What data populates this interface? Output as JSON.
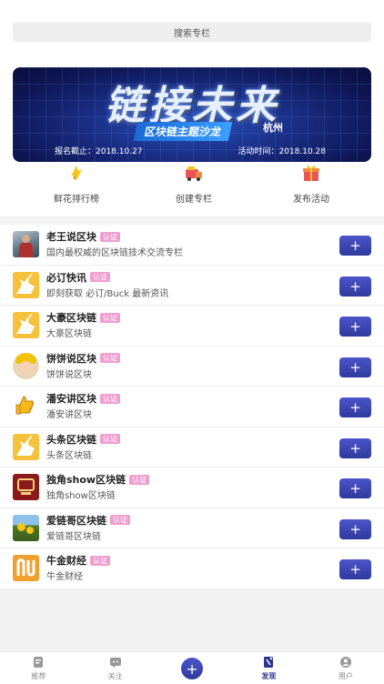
{
  "search": {
    "placeholder": "搜索专栏"
  },
  "banner": {
    "title": "链接未来",
    "subtitle": "区块链主题沙龙",
    "city": "杭州",
    "deadline": "报名截止：2018.10.27",
    "date": "活动时间：2018.10.28"
  },
  "quick_actions": [
    {
      "label": "鲜花排行榜",
      "icon": "flower-ranking-icon"
    },
    {
      "label": "创建专栏",
      "icon": "create-column-icon"
    },
    {
      "label": "发布活动",
      "icon": "gift-event-icon"
    }
  ],
  "columns": [
    {
      "name": "老王说区块",
      "verified": "认证",
      "desc": "国内最权威的区块链技术交流专栏",
      "avatar": "person-photo"
    },
    {
      "name": "必订快讯",
      "verified": "认证",
      "desc": "即刻获取 必订/Buck 最新资讯",
      "avatar": "unicorn"
    },
    {
      "name": "大豪区块链",
      "verified": "认证",
      "desc": "大豪区块链",
      "avatar": "unicorn"
    },
    {
      "name": "饼饼说区块",
      "verified": "认证",
      "desc": "饼饼说区块",
      "avatar": "child-photo"
    },
    {
      "name": "潘安讲区块",
      "verified": "认证",
      "desc": "潘安讲区块",
      "avatar": "thumb-up"
    },
    {
      "name": "头条区块链",
      "verified": "认证",
      "desc": "头条区块链",
      "avatar": "unicorn"
    },
    {
      "name": "独角show区块链",
      "verified": "认证",
      "desc": "独角show区块链",
      "avatar": "chain-logo"
    },
    {
      "name": "爱链哥区块链",
      "verified": "认证",
      "desc": "爱链哥区块链",
      "avatar": "sunflower"
    },
    {
      "name": "牛金财经",
      "verified": "认证",
      "desc": "牛金财经",
      "avatar": "nj-logo"
    }
  ],
  "follow_label": "+",
  "tabs": [
    {
      "label": "推荐",
      "icon": "recommend-icon"
    },
    {
      "label": "关注",
      "icon": "follow-icon"
    },
    {
      "label": "",
      "icon": "add-icon",
      "center": "+"
    },
    {
      "label": "发现",
      "icon": "discover-icon",
      "active": true
    },
    {
      "label": "用户",
      "icon": "user-icon"
    }
  ],
  "colors": {
    "accent": "#2f3a9e",
    "badge": "#ee9fd0"
  }
}
